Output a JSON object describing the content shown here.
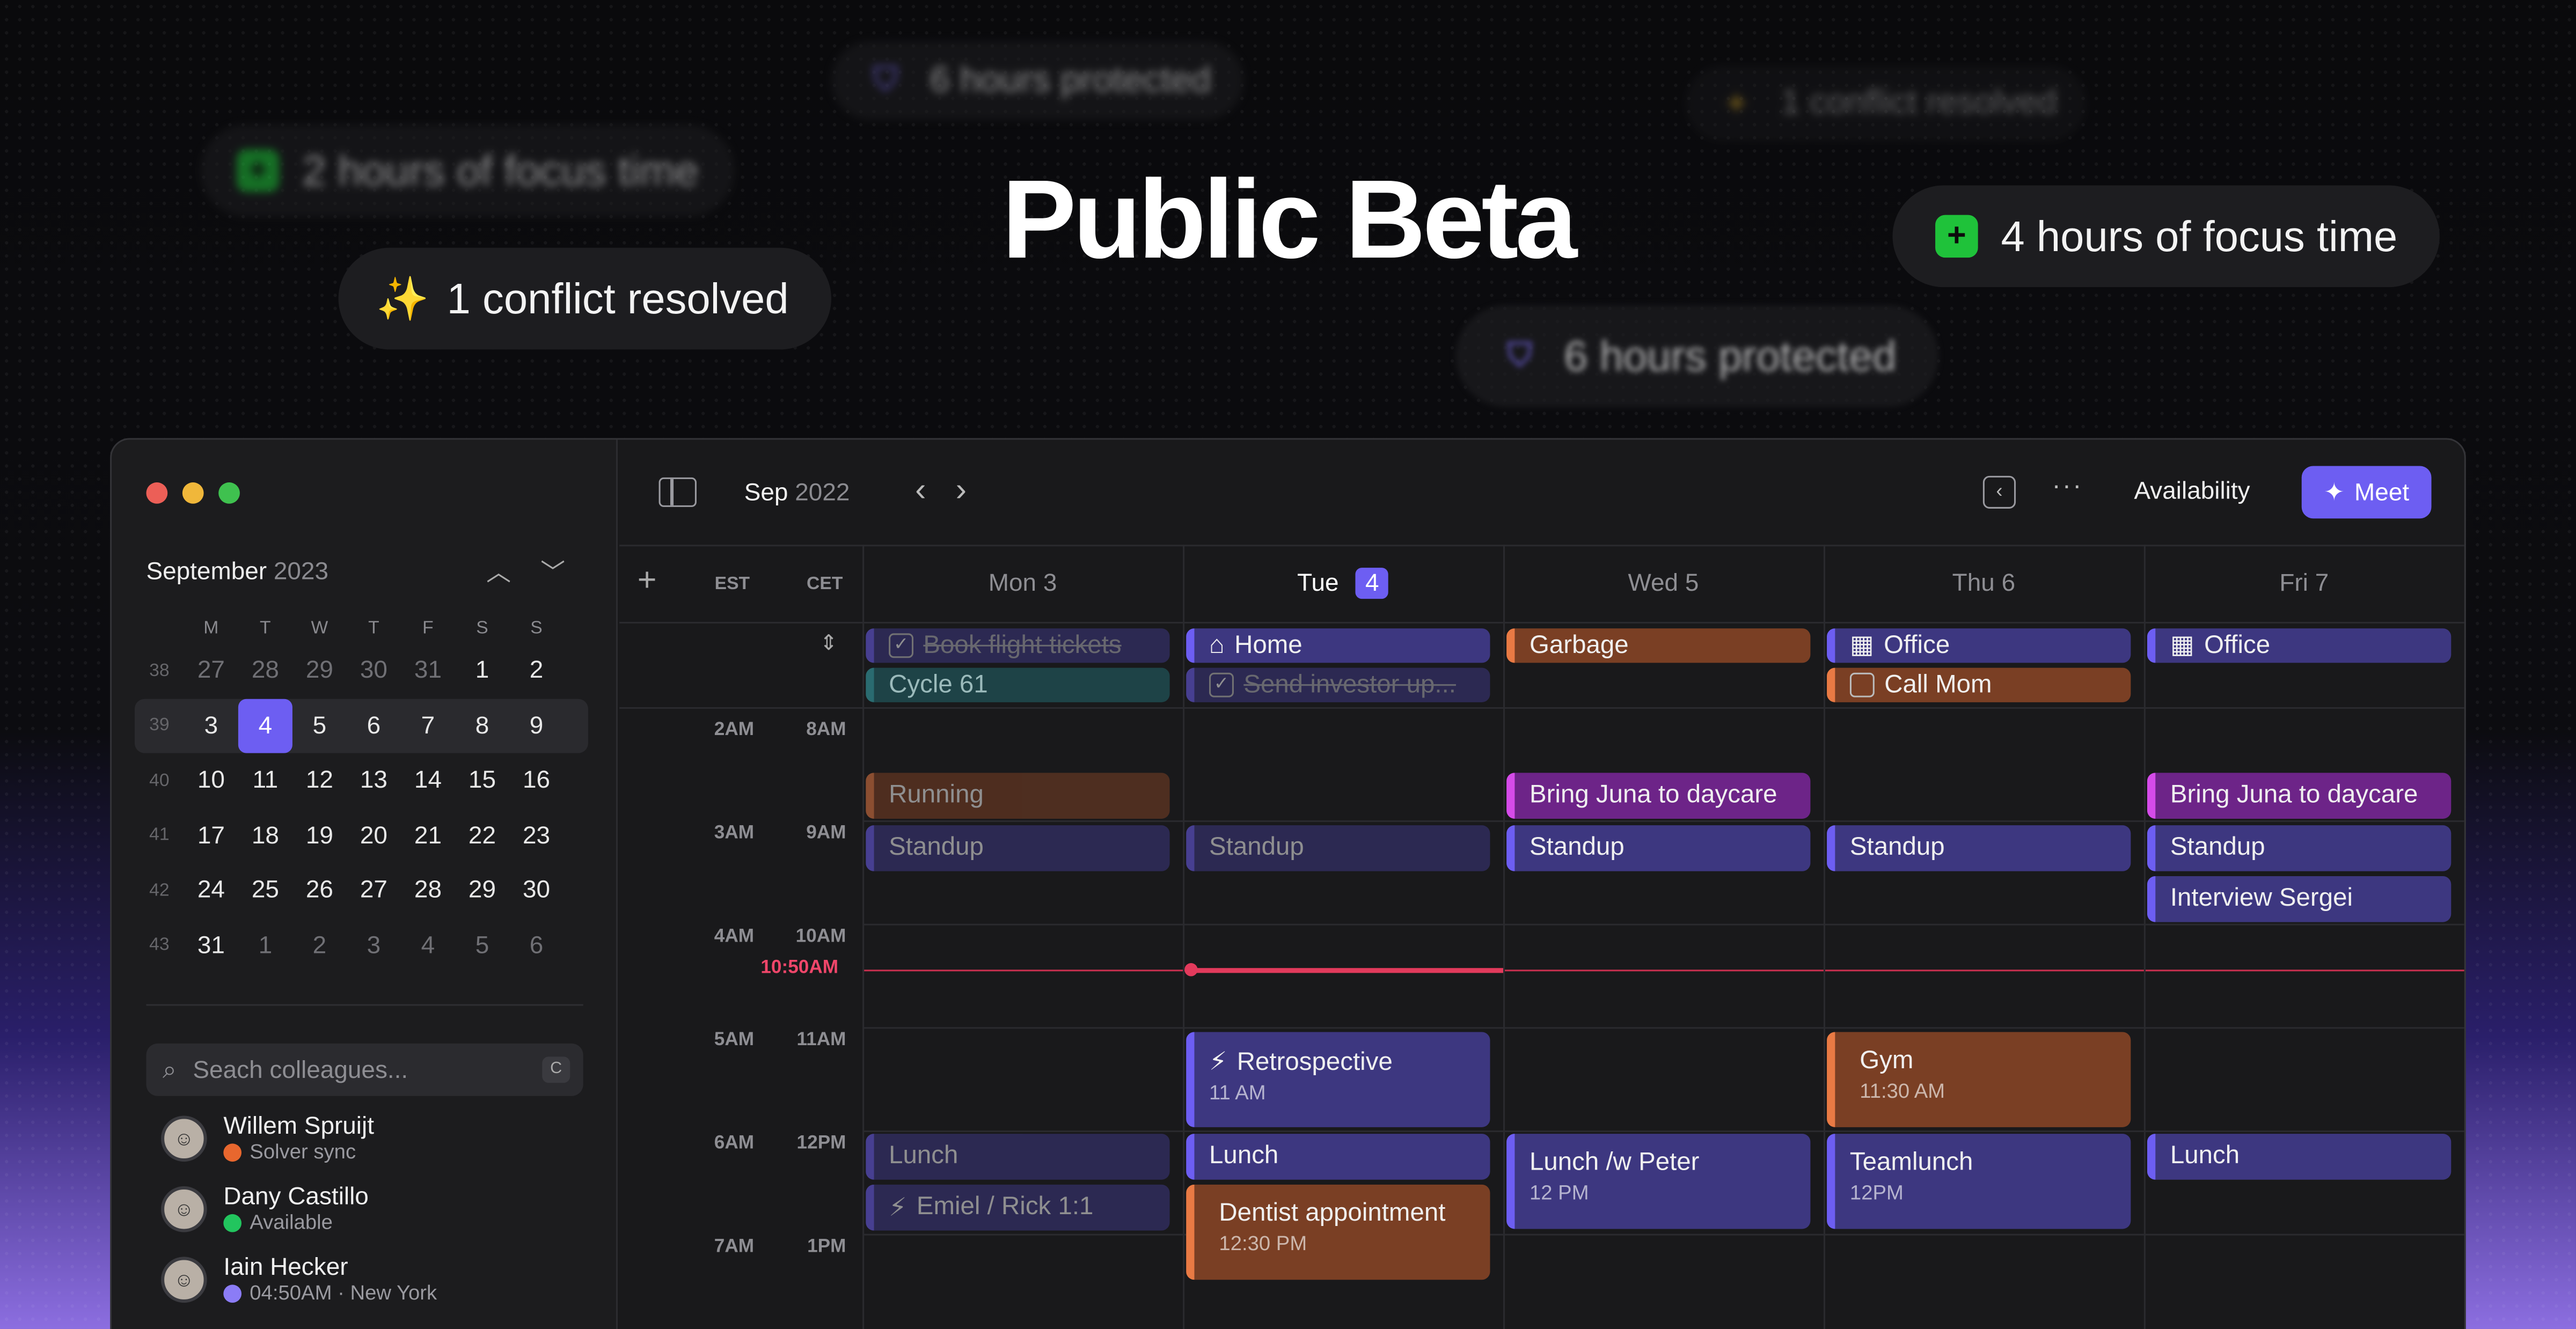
{
  "hero": {
    "title": "Public Beta",
    "pills": {
      "focus_blurred": "2 hours of focus time",
      "protected_top_blurred": "6 hours protected",
      "conflict_blurred": "1 conflict resolved",
      "conflict": "1 conflict resolved",
      "focus": "4 hours of focus time",
      "protected": "6 hours protected"
    }
  },
  "sidebar": {
    "mini_calendar": {
      "month": "September",
      "year": "2023",
      "weekdays": [
        "M",
        "T",
        "W",
        "T",
        "F",
        "S",
        "S"
      ],
      "weeks": [
        {
          "num": "38",
          "days": [
            "27",
            "28",
            "29",
            "30",
            "31",
            "1",
            "2"
          ]
        },
        {
          "num": "39",
          "days": [
            "3",
            "4",
            "5",
            "6",
            "7",
            "8",
            "9"
          ]
        },
        {
          "num": "40",
          "days": [
            "10",
            "11",
            "12",
            "13",
            "14",
            "15",
            "16"
          ]
        },
        {
          "num": "41",
          "days": [
            "17",
            "18",
            "19",
            "20",
            "21",
            "22",
            "23"
          ]
        },
        {
          "num": "42",
          "days": [
            "24",
            "25",
            "26",
            "27",
            "28",
            "29",
            "30"
          ]
        },
        {
          "num": "43",
          "days": [
            "31",
            "1",
            "2",
            "3",
            "4",
            "5",
            "6"
          ]
        }
      ],
      "today": "4"
    },
    "search": {
      "placeholder": "Seach colleagues...",
      "shortcut": "C"
    },
    "people": [
      {
        "name": "Willem Spruijt",
        "status": "Solver sync",
        "status_color": "#e8672e"
      },
      {
        "name": "Dany Castillo",
        "status": "Available",
        "status_color": "#22c55e"
      },
      {
        "name": "Iain Hecker",
        "status": "04:50AM · New York",
        "status_color": "#8b7cf6"
      }
    ]
  },
  "toolbar": {
    "month": "Sep",
    "year": "2022",
    "availability_label": "Availability",
    "meet_label": "Meet"
  },
  "timezones": [
    "EST",
    "CET"
  ],
  "days": [
    {
      "name": "Mon",
      "num": "3"
    },
    {
      "name": "Tue",
      "num": "4"
    },
    {
      "name": "Wed",
      "num": "5"
    },
    {
      "name": "Thu",
      "num": "6"
    },
    {
      "name": "Fri",
      "num": "7"
    }
  ],
  "time_labels": [
    {
      "est": "2AM",
      "cet": "8AM"
    },
    {
      "est": "3AM",
      "cet": "9AM"
    },
    {
      "est": "4AM",
      "cet": "10AM"
    },
    {
      "est": "5AM",
      "cet": "11AM"
    },
    {
      "est": "6AM",
      "cet": "12PM"
    },
    {
      "est": "7AM",
      "cet": "1PM"
    }
  ],
  "now_label": "10:50AM",
  "allday_events": [
    {
      "title": "Book flight tickets"
    },
    {
      "title": "Cycle 61"
    },
    {
      "title": "Home"
    },
    {
      "title": "Send investor up..."
    },
    {
      "title": "Garbage"
    },
    {
      "title": "Office"
    },
    {
      "title": "Call Mom"
    },
    {
      "title": "Office"
    }
  ],
  "events": [
    {
      "title": "Running"
    },
    {
      "title": "Standup"
    },
    {
      "title": "Lunch"
    },
    {
      "title": "Emiel / Rick 1:1"
    },
    {
      "title": "Standup"
    },
    {
      "title": "Retrospective",
      "time": "11 AM"
    },
    {
      "title": "Lunch"
    },
    {
      "title": "Dentist appointment",
      "time": "12:30 PM"
    },
    {
      "title": "Bring Juna to daycare"
    },
    {
      "title": "Standup"
    },
    {
      "title": "Lunch /w Peter",
      "time": "12 PM"
    },
    {
      "title": "Standup"
    },
    {
      "title": "Gym",
      "time": "11:30 AM"
    },
    {
      "title": "Teamlunch",
      "time": "12PM"
    },
    {
      "title": "Bring Juna to daycare"
    },
    {
      "title": "Standup"
    },
    {
      "title": "Interview Sergei"
    },
    {
      "title": "Lunch"
    }
  ]
}
